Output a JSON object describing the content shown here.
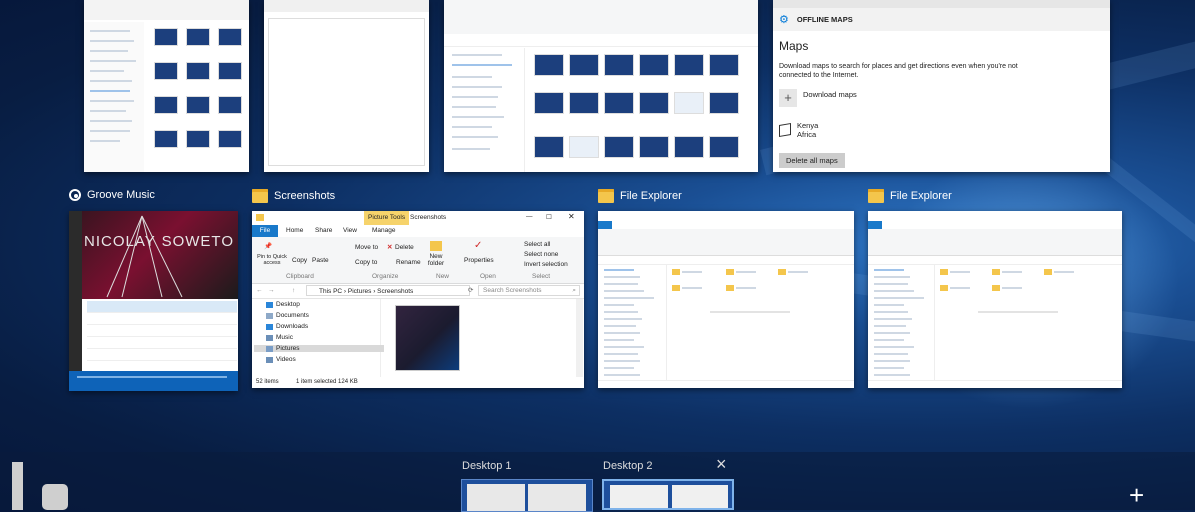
{
  "top_row": {
    "maps": {
      "header": "OFFLINE MAPS",
      "title": "Maps",
      "description": "Download maps to search for places and get directions even when you're not connected to the Internet.",
      "download_label": "Download maps",
      "map_region": "Kenya",
      "map_continent": "Africa",
      "delete_label": "Delete all maps"
    }
  },
  "windows": {
    "groove": {
      "title": "Groove Music",
      "artist_left": "NICOLAY",
      "artist_right": "SOWETO"
    },
    "screenshots": {
      "title": "Screenshots",
      "context_tab": "Picture Tools",
      "window_label": "Screenshots",
      "tabs": [
        "File",
        "Home",
        "Share",
        "View",
        "Manage"
      ],
      "ribbon": {
        "pin": "Pin to Quick access",
        "copy": "Copy",
        "paste": "Paste",
        "move_to": "Move to",
        "delete": "Delete",
        "copy_to": "Copy to",
        "rename": "Rename",
        "new_folder": "New folder",
        "properties": "Properties",
        "select_all": "Select all",
        "select_none": "Select none",
        "invert_selection": "Invert selection",
        "group_clipboard": "Clipboard",
        "group_organize": "Organize",
        "group_new": "New",
        "group_open": "Open",
        "group_select": "Select"
      },
      "breadcrumb": [
        "This PC",
        "Pictures",
        "Screenshots"
      ],
      "search_placeholder": "Search Screenshots",
      "nav_items": [
        "Desktop",
        "Documents",
        "Downloads",
        "Music",
        "Pictures",
        "Videos"
      ],
      "status_items": "52 items",
      "status_selected": "1 item selected  124 KB"
    },
    "explorer1": {
      "title": "File Explorer"
    },
    "explorer2": {
      "title": "File Explorer"
    }
  },
  "desktops": {
    "items": [
      {
        "label": "Desktop 1"
      },
      {
        "label": "Desktop 2"
      }
    ],
    "close_icon": "×",
    "add_icon": "+"
  },
  "colors": {
    "accent": "#0078d7",
    "folder": "#f4c64c",
    "background_dark": "#081d42"
  }
}
